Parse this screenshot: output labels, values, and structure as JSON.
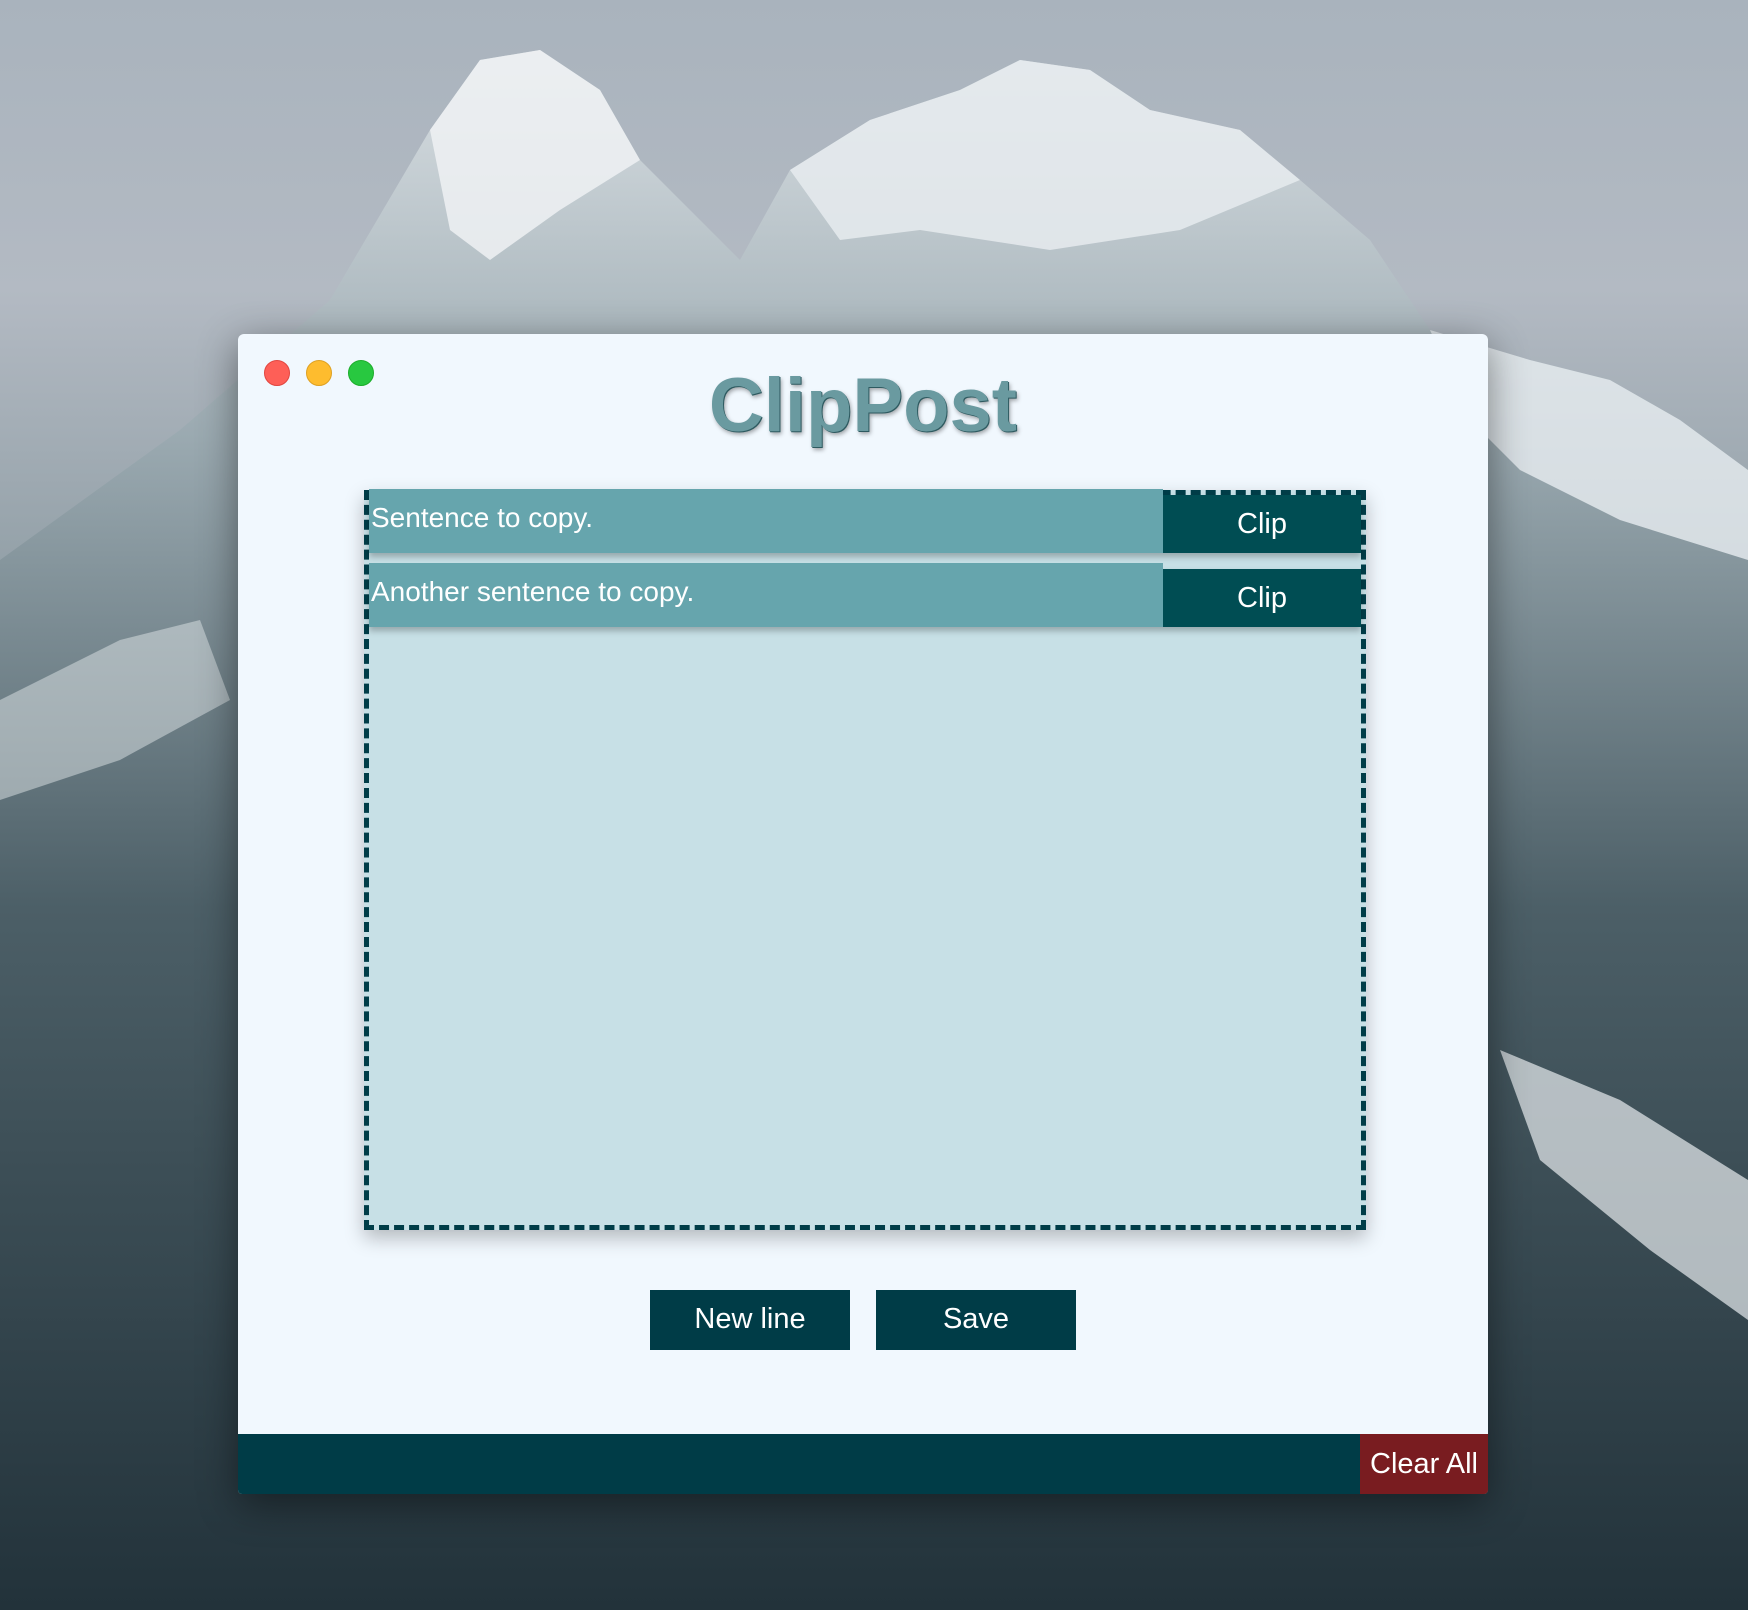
{
  "window": {
    "title": "ClipPost"
  },
  "clips": [
    {
      "text": "Sentence to copy.",
      "button_label": "Clip"
    },
    {
      "text": "Another sentence to copy.",
      "button_label": "Clip"
    }
  ],
  "actions": {
    "new_line_label": "New line",
    "save_label": "Save",
    "clear_all_label": "Clear All"
  },
  "colors": {
    "window_bg": "#f1f8fe",
    "clip_area_bg": "#c7e0e6",
    "row_bg": "#66a5ad",
    "primary_dark": "#003c47",
    "danger": "#791c20"
  }
}
